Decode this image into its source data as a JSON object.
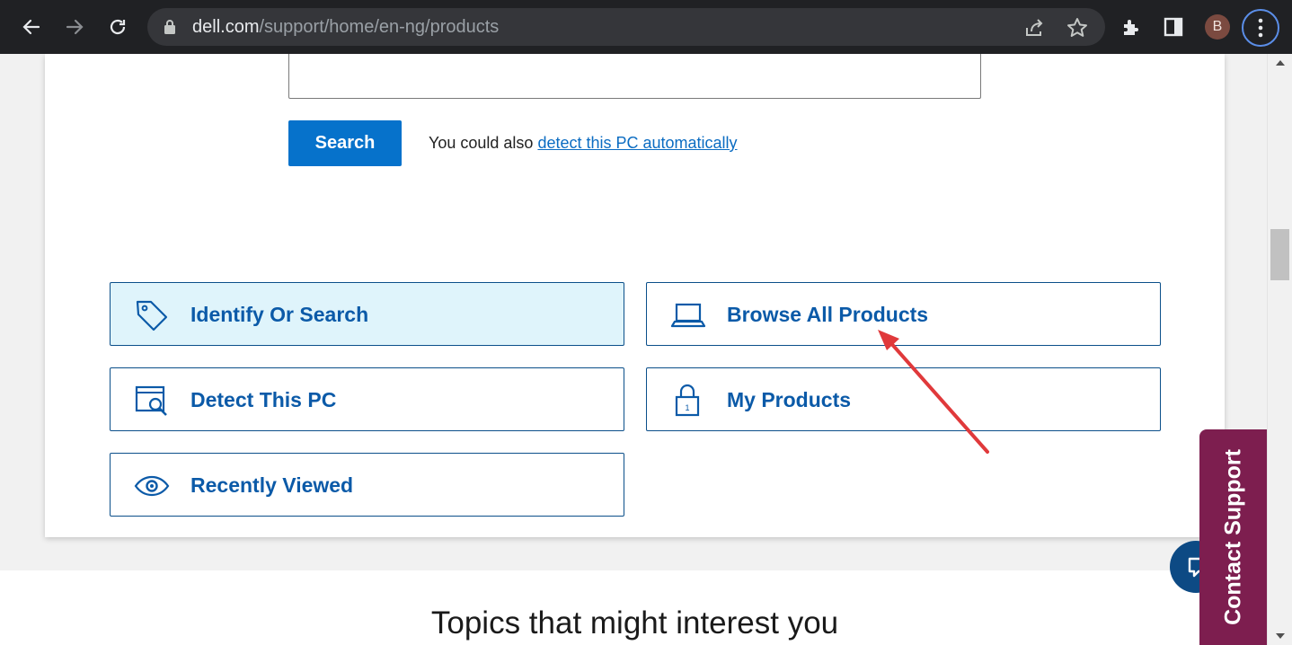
{
  "browser": {
    "url_host": "dell.com",
    "url_path": "/support/home/en-ng/products",
    "avatar_letter": "B",
    "icons": [
      "back-icon",
      "forward-icon",
      "reload-icon",
      "lock-icon",
      "share-icon",
      "star-icon",
      "extensions-icon",
      "side-panel-icon",
      "menu-icon"
    ]
  },
  "search": {
    "button_label": "Search",
    "detect_prefix": "You could also ",
    "detect_link": "detect this PC automatically"
  },
  "tiles": [
    {
      "label": "Identify Or Search",
      "icon": "tag-icon",
      "active": true
    },
    {
      "label": "Browse All Products",
      "icon": "laptop-icon",
      "active": false
    },
    {
      "label": "Detect This PC",
      "icon": "detect-pc-icon",
      "active": false
    },
    {
      "label": "My Products",
      "icon": "lock-icon",
      "active": false
    },
    {
      "label": "Recently Viewed",
      "icon": "eye-icon",
      "active": false
    }
  ],
  "topics_heading": "Topics that might interest you",
  "contact_support": "Contact Support",
  "colors": {
    "primary": "#0672cb",
    "tile_text": "#0b5aa8",
    "active_tile_bg": "#dff4fb",
    "contact_tab": "#7d1e4f",
    "annotation_arrow": "#e0393b"
  }
}
